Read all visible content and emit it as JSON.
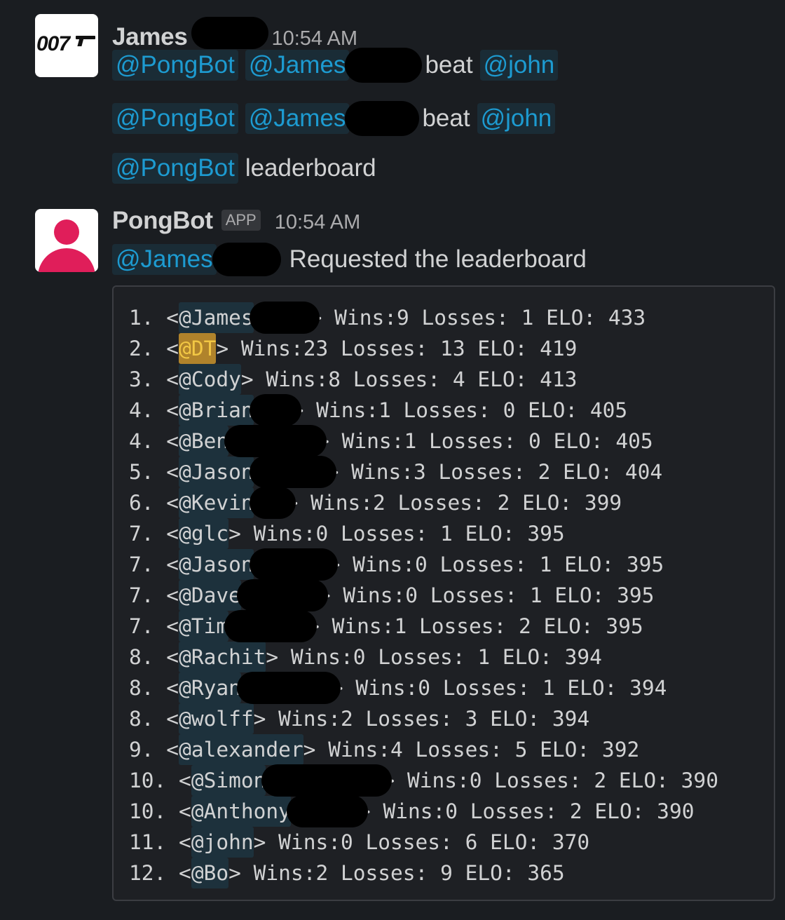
{
  "messages": [
    {
      "sender": "James",
      "timestamp": "10:54 AM",
      "avatar_icon": "007-logo-icon",
      "avatar_text": "007",
      "lines": [
        {
          "parts": [
            {
              "type": "mention",
              "text": "@PongBot"
            },
            {
              "type": "mention",
              "text": "@James"
            },
            {
              "type": "text",
              "text": "beat"
            },
            {
              "type": "mention",
              "text": "@john"
            }
          ]
        },
        {
          "parts": [
            {
              "type": "mention",
              "text": "@PongBot"
            },
            {
              "type": "mention",
              "text": "@James"
            },
            {
              "type": "text",
              "text": "beat"
            },
            {
              "type": "mention",
              "text": "@john"
            }
          ]
        },
        {
          "parts": [
            {
              "type": "mention",
              "text": "@PongBot"
            },
            {
              "type": "text",
              "text": "leaderboard"
            }
          ]
        }
      ]
    },
    {
      "sender": "PongBot",
      "badge": "APP",
      "timestamp": "10:54 AM",
      "avatar_icon": "user-silhouette-icon",
      "intro_mention": "@James",
      "intro_text": "Requested the leaderboard"
    }
  ],
  "leaderboard": [
    {
      "rank": "1.",
      "name": "@James",
      "stats": "Wins:9 Losses: 1 ELO: 433"
    },
    {
      "rank": "2.",
      "name": "@DT",
      "stats": "Wins:23 Losses: 13 ELO: 419",
      "highlight": true
    },
    {
      "rank": "3.",
      "name": "@Cody",
      "stats": "Wins:8 Losses: 4 ELO: 413"
    },
    {
      "rank": "4.",
      "name": "@Brian",
      "stats": "Wins:1 Losses: 0 ELO: 405"
    },
    {
      "rank": "4.",
      "name": "@Ben",
      "stats": "Wins:1 Losses: 0 ELO: 405"
    },
    {
      "rank": "5.",
      "name": "@Jason",
      "stats": "Wins:3 Losses: 2 ELO: 404"
    },
    {
      "rank": "6.",
      "name": "@Kevin",
      "stats": "Wins:2 Losses: 2 ELO: 399"
    },
    {
      "rank": "7.",
      "name": "@glc",
      "stats": "Wins:0 Losses: 1 ELO: 395"
    },
    {
      "rank": "7.",
      "name": "@Jason",
      "stats": "Wins:0 Losses: 1 ELO: 395"
    },
    {
      "rank": "7.",
      "name": "@Dave",
      "stats": "Wins:0 Losses: 1 ELO: 395"
    },
    {
      "rank": "7.",
      "name": "@Tim",
      "stats": "Wins:1 Losses: 2 ELO: 395"
    },
    {
      "rank": "8.",
      "name": "@Rachit",
      "stats": "Wins:0 Losses: 1 ELO: 394"
    },
    {
      "rank": "8.",
      "name": "@Ryan",
      "stats": "Wins:0 Losses: 1 ELO: 394"
    },
    {
      "rank": "8.",
      "name": "@wolff",
      "stats": "Wins:2 Losses: 3 ELO: 394"
    },
    {
      "rank": "9.",
      "name": "@alexander",
      "stats": "Wins:4 Losses: 5 ELO: 392"
    },
    {
      "rank": "10.",
      "name": "@Simon",
      "stats": "Wins:0 Losses: 2 ELO: 390"
    },
    {
      "rank": "10.",
      "name": "@Anthony",
      "stats": "Wins:0 Losses: 2 ELO: 390"
    },
    {
      "rank": "11.",
      "name": "@john",
      "stats": "Wins:0 Losses: 6 ELO: 370"
    },
    {
      "rank": "12.",
      "name": "@Bo",
      "stats": "Wins:2 Losses: 9 ELO: 365"
    }
  ],
  "colors": {
    "background": "#1a1d21",
    "mention": "#1d9bd1",
    "highlight_mention": "#f2c744",
    "avatar_bot": "#e01e5a"
  }
}
